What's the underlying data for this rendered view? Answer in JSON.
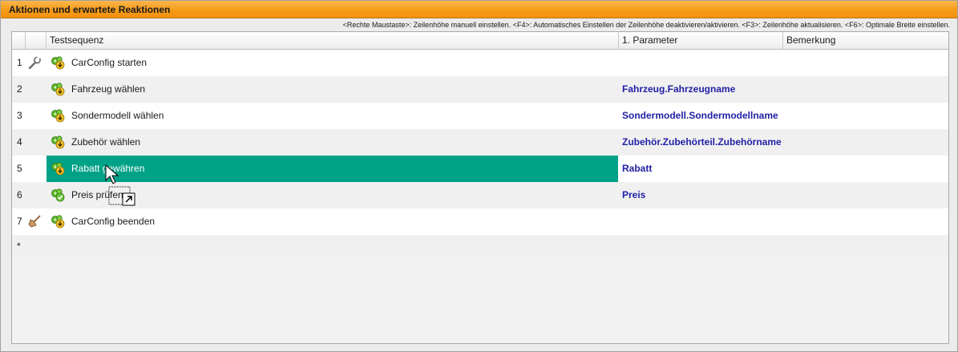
{
  "panel": {
    "title": "Aktionen und erwartete Reaktionen",
    "hint": "<Rechte Maustaste>: Zeilenhöhe manuell einstellen. <F4>: Automatisches Einstellen der Zeilenhöhe deaktivieren/aktivieren. <F3>: Zeilenhöhe aktualisieren. <F6>: Optimale Breite einstellen."
  },
  "table": {
    "columns": [
      "",
      "",
      "Testsequenz",
      "1. Parameter",
      "Bemerkung"
    ],
    "rows": [
      {
        "num": "1",
        "tool": "wrench-icon",
        "action": "CarConfig starten",
        "param": "",
        "remark": ""
      },
      {
        "num": "2",
        "tool": "",
        "action": "Fahrzeug wählen",
        "param": "Fahrzeug.Fahrzeugname",
        "remark": ""
      },
      {
        "num": "3",
        "tool": "",
        "action": "Sondermodell wählen",
        "param": "Sondermodell.Sondermodellname",
        "remark": ""
      },
      {
        "num": "4",
        "tool": "",
        "action": "Zubehör wählen",
        "param": "Zubehör.Zubehörteil.Zubehörname",
        "remark": ""
      },
      {
        "num": "5",
        "tool": "",
        "action": "Rabatt gewähren",
        "param": "Rabatt",
        "remark": "",
        "selected": true
      },
      {
        "num": "6",
        "tool": "",
        "action": "Preis prüfen",
        "param": "Preis",
        "remark": ""
      },
      {
        "num": "7",
        "tool": "broom-icon",
        "action": "CarConfig beenden",
        "param": "",
        "remark": ""
      }
    ],
    "new_row_marker": "*"
  },
  "colors": {
    "title_bar": "#f59a15",
    "selection": "#00a287",
    "parameter_text": "#1f1fa4"
  }
}
